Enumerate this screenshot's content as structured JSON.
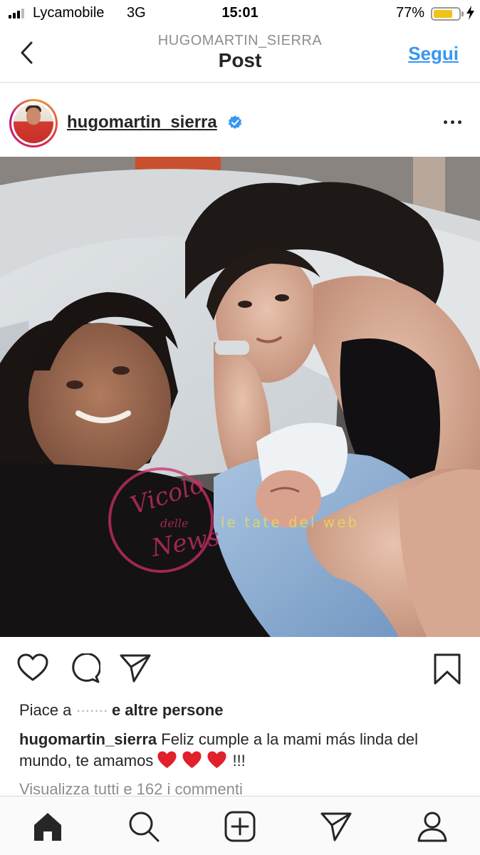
{
  "status_bar": {
    "carrier": "Lycamobile",
    "network": "3G",
    "time": "15:01",
    "battery_percent": "77%",
    "battery_level": 0.77,
    "battery_color": "#f2c317",
    "icons": [
      "signal-icon",
      "battery-icon",
      "charging-bolt-icon"
    ]
  },
  "nav": {
    "subtitle": "HUGOMARTIN_SIERRA",
    "title": "Post",
    "follow_label": "Segui",
    "back_icon": "chevron-left-icon"
  },
  "post": {
    "username": "hugomartin_sierra",
    "verified": true,
    "more_icon": "more-horizontal-icon",
    "image_alt": "Selfie of a man and a woman lying in a hospital bed with a newborn baby",
    "watermarks": [
      "Vicolo delle News",
      "le tate del web"
    ],
    "actions": {
      "like_icon": "heart-outline-icon",
      "comment_icon": "comment-bubble-icon",
      "share_icon": "paper-plane-icon",
      "save_icon": "bookmark-icon"
    },
    "likes_prefix": "Piace a",
    "likes_obscured": "·······",
    "likes_suffix": "e altre persone",
    "caption_user": "hugomartin_sierra",
    "caption_text": "Feliz cumple a la mami más linda del mundo, te amamos",
    "caption_emoji_count": 3,
    "caption_end": "!!!",
    "view_comments": "Visualizza tutti e 162 i commenti"
  },
  "tab_bar": {
    "items": [
      "home-icon",
      "search-icon",
      "new-post-icon",
      "direct-icon",
      "profile-icon"
    ],
    "active": "home-icon"
  },
  "colors": {
    "accent_blue": "#3897f0",
    "heart_red": "#e0202a",
    "text": "#262626",
    "muted": "#8e8e8e",
    "divider": "#dbdbdb"
  }
}
